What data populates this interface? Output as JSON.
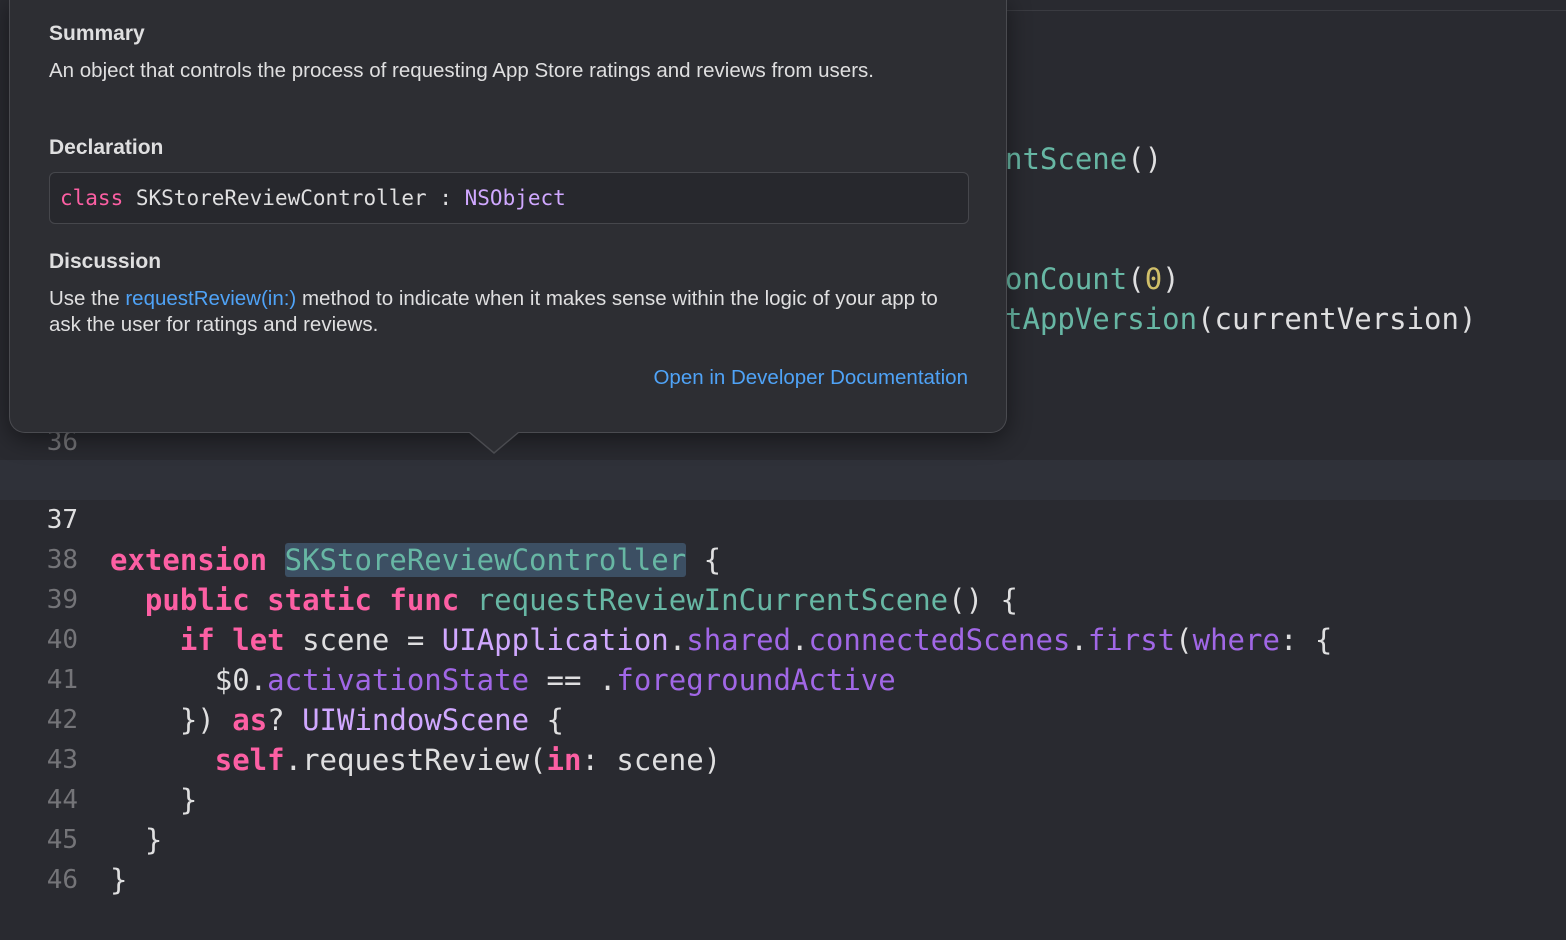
{
  "popover": {
    "summary_heading": "Summary",
    "summary_text": "An object that controls the process of requesting App Store ratings and reviews from users.",
    "declaration_heading": "Declaration",
    "declaration": {
      "keyword": "class",
      "name": "SKStoreReviewController",
      "colon": ":",
      "superclass": "NSObject"
    },
    "discussion_heading": "Discussion",
    "discussion_prefix": "Use the ",
    "discussion_link": "requestReview(in:)",
    "discussion_suffix": " method to indicate when it makes sense within the logic of your app to ask the user for ratings and reviews.",
    "doc_link": "Open in Developer Documentation"
  },
  "partial_code": {
    "line_a": {
      "fn": "ntScene",
      "rest": "()"
    },
    "line_b": {
      "fn": "onCount",
      "open": "(",
      "num": "0",
      "close": ")"
    },
    "line_c": {
      "fn": "tAppVersion",
      "rest": "(currentVersion)"
    }
  },
  "editor": {
    "line_numbers": [
      "36",
      "37",
      "38",
      "39",
      "40",
      "41",
      "42",
      "43",
      "44",
      "45",
      "46"
    ],
    "current_line": "37",
    "code": {
      "l37": {
        "kw": "extension",
        "type": "SKStoreReviewController",
        "rest": "{"
      },
      "l38": {
        "kw1": "public",
        "kw2": "static",
        "kw3": "func",
        "fn": "requestReviewInCurrentScene",
        "rest": "() {"
      },
      "l39": {
        "kw1": "if",
        "kw2": "let",
        "t1": "scene = ",
        "type": "UIApplication",
        "dot1": ".",
        "m1": "shared",
        "dot2": ".",
        "m2": "connectedScenes",
        "dot3": ".",
        "m3": "first",
        "p1": "(",
        "m4": "where",
        "rest": ": {"
      },
      "l40": {
        "t1": "$0.",
        "m1": "activationState",
        "t2": " == .",
        "m2": "foregroundActive"
      },
      "l41": {
        "t1": "}) ",
        "kw": "as",
        "t2": "? ",
        "type": "UIWindowScene",
        "rest": " {"
      },
      "l42": {
        "kw": "self",
        "t1": ".requestReview(",
        "kw2": "in",
        "rest": ": scene)"
      },
      "l43": {
        "t1": "}"
      },
      "l44": {
        "t1": "}"
      },
      "l45": {
        "t1": "}"
      }
    }
  }
}
